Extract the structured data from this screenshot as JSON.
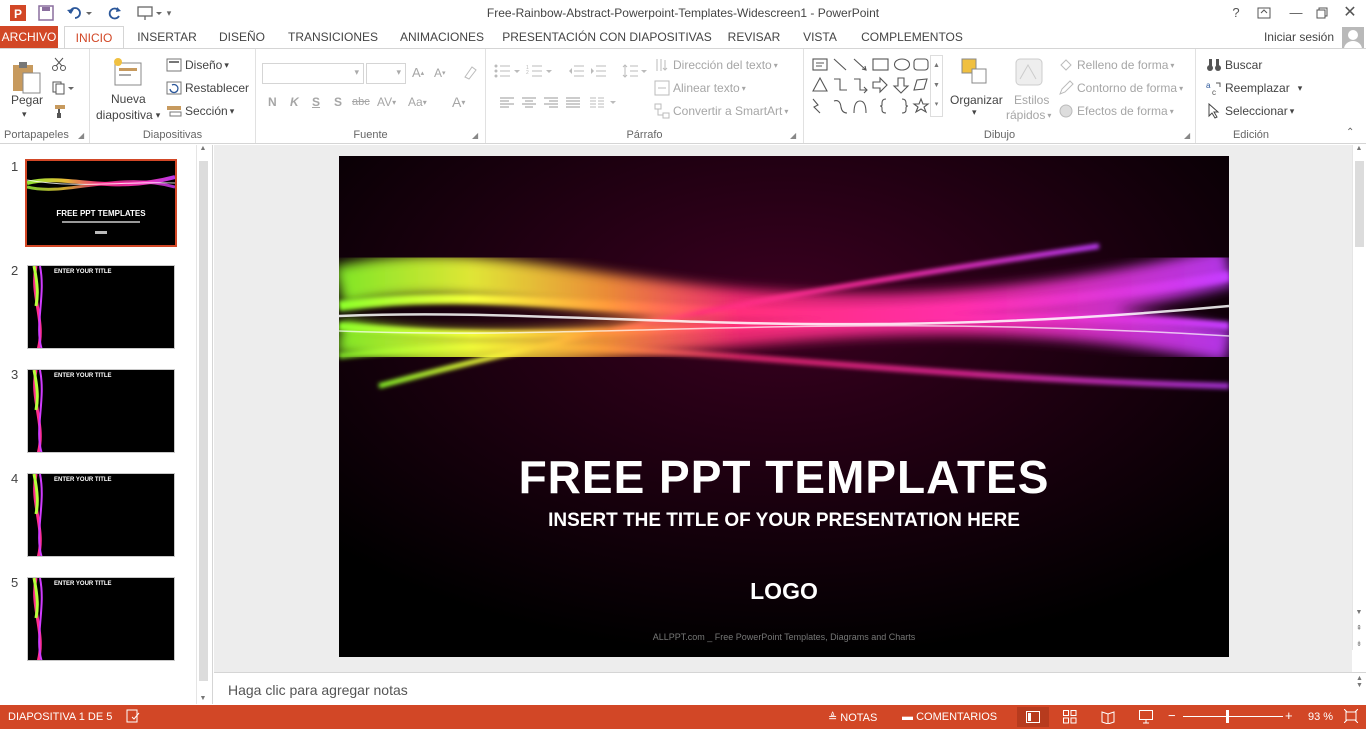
{
  "window": {
    "title": "Free-Rainbow-Abstract-Powerpoint-Templates-Widescreen1 - PowerPoint"
  },
  "tabs": [
    "ARCHIVO",
    "INICIO",
    "INSERTAR",
    "DISEÑO",
    "TRANSICIONES",
    "ANIMACIONES",
    "PRESENTACIÓN CON DIAPOSITIVAS",
    "REVISAR",
    "VISTA",
    "COMPLEMENTOS"
  ],
  "active_tab": "INICIO",
  "signin": "Iniciar sesión",
  "ribbon": {
    "portapapeles": {
      "label": "Portapapeles",
      "pegar": "Pegar"
    },
    "diapositivas": {
      "label": "Diapositivas",
      "nueva": "Nueva",
      "nueva2": "diapositiva",
      "diseno": "Diseño",
      "restablecer": "Restablecer",
      "seccion": "Sección"
    },
    "fuente": {
      "label": "Fuente"
    },
    "parrafo": {
      "label": "Párrafo",
      "direccion": "Dirección del texto",
      "alinear": "Alinear texto",
      "convertir": "Convertir a SmartArt"
    },
    "dibujo": {
      "label": "Dibujo",
      "organizar": "Organizar",
      "estilos": "Estilos",
      "rapidos": "rápidos",
      "relleno": "Relleno de forma",
      "contorno": "Contorno de forma",
      "efectos": "Efectos de forma"
    },
    "edicion": {
      "label": "Edición",
      "buscar": "Buscar",
      "reemplazar": "Reemplazar",
      "seleccionar": "Seleccionar"
    }
  },
  "thumbnails": [
    {
      "num": "1",
      "title": "FREE PPT TEMPLATES"
    },
    {
      "num": "2",
      "title": "ENTER YOUR TITLE"
    },
    {
      "num": "3",
      "title": "ENTER YOUR TITLE"
    },
    {
      "num": "4",
      "title": "ENTER YOUR TITLE"
    },
    {
      "num": "5",
      "title": "ENTER YOUR TITLE"
    }
  ],
  "slide": {
    "title": "FREE PPT TEMPLATES",
    "subtitle": "INSERT THE TITLE OF YOUR PRESENTATION HERE",
    "logo": "LOGO",
    "footer": "ALLPPT.com _ Free PowerPoint Templates, Diagrams and Charts"
  },
  "notes_placeholder": "Haga clic para agregar notas",
  "status": {
    "slide": "DIAPOSITIVA 1 DE 5",
    "notas": "NOTAS",
    "comentarios": "COMENTARIOS",
    "zoom": "93 %"
  },
  "colors": {
    "accent": "#d24726"
  }
}
